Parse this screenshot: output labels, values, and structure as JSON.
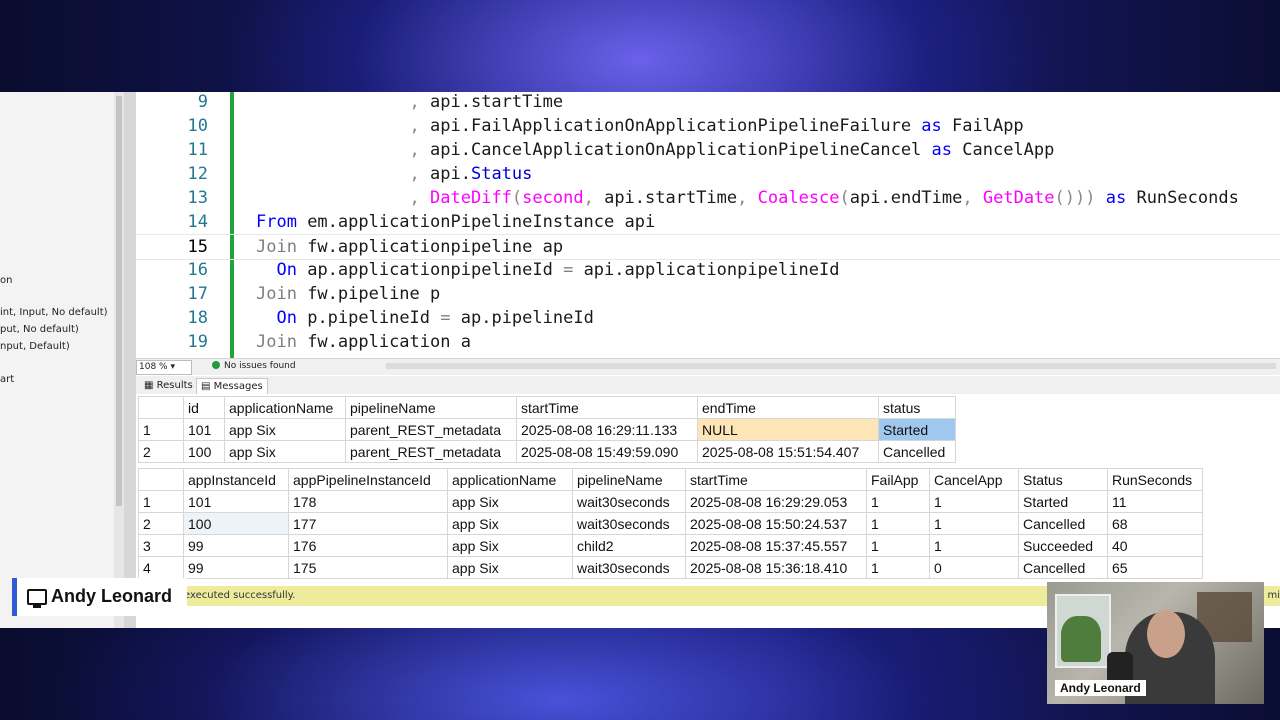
{
  "left_pane": {
    "fragments": [
      "on",
      "int, Input, No default)",
      "put, No default)",
      "nput, Default)",
      "art"
    ]
  },
  "editor": {
    "lines": [
      {
        "num": "9",
        "html": "               <span class=\"pu\">,</span> api.startTime"
      },
      {
        "num": "10",
        "html": "               <span class=\"pu\">,</span> api.FailApplicationOnApplicationPipelineFailure <span class=\"kw\">as</span> FailApp"
      },
      {
        "num": "11",
        "html": "               <span class=\"pu\">,</span> api.CancelApplicationOnApplicationPipelineCancel <span class=\"kw\">as</span> CancelApp"
      },
      {
        "num": "12",
        "html": "               <span class=\"pu\">,</span> api.<span class=\"sys\">Status</span>"
      },
      {
        "num": "13",
        "html": "               <span class=\"pu\">,</span> <span class=\"fn\">DateDiff</span><span class=\"pu\">(</span><span class=\"fn\">second</span><span class=\"pu\">,</span> api.startTime<span class=\"pu\">,</span> <span class=\"fn\">Coalesce</span><span class=\"pu\">(</span>api.endTime<span class=\"pu\">,</span> <span class=\"fn\">GetDate</span><span class=\"pu\">()))</span> <span class=\"kw\">as</span> RunSeconds"
      },
      {
        "num": "14",
        "html": "<span class=\"kw\">From</span> em.applicationPipelineInstance api"
      },
      {
        "num": "15",
        "html": "<span class=\"gr\">Join</span> fw.applicationpipeline ap"
      },
      {
        "num": "16",
        "html": "  <span class=\"kw\">On</span> ap.applicationpipelineId <span class=\"gr\">=</span> api.applicationpipelineId"
      },
      {
        "num": "17",
        "html": "<span class=\"gr\">Join</span> fw.pipeline p"
      },
      {
        "num": "18",
        "html": "  <span class=\"kw\">On</span> p.pipelineId <span class=\"gr\">=</span> ap.pipelineId"
      },
      {
        "num": "19",
        "html": "<span class=\"gr\">Join</span> fw.application a"
      }
    ],
    "current_line": "15"
  },
  "status_strip": {
    "zoom": "108 %",
    "issues": "No issues found"
  },
  "tabs": {
    "results": "Results",
    "messages": "Messages"
  },
  "grid1": {
    "columns": [
      "",
      "id",
      "applicationName",
      "pipelineName",
      "startTime",
      "endTime",
      "status"
    ],
    "rows": [
      [
        "1",
        "101",
        "app Six",
        "parent_REST_metadata",
        "2025-08-08 16:29:11.133",
        "NULL",
        "Started"
      ],
      [
        "2",
        "100",
        "app Six",
        "parent_REST_metadata",
        "2025-08-08 15:49:59.090",
        "2025-08-08 15:51:54.407",
        "Cancelled"
      ]
    ]
  },
  "grid2": {
    "columns": [
      "",
      "appInstanceId",
      "appPipelineInstanceId",
      "applicationName",
      "pipelineName",
      "startTime",
      "FailApp",
      "CancelApp",
      "Status",
      "RunSeconds"
    ],
    "rows": [
      [
        "1",
        "101",
        "178",
        "app Six",
        "wait30seconds",
        "2025-08-08 16:29:29.053",
        "1",
        "1",
        "Started",
        "11"
      ],
      [
        "2",
        "100",
        "177",
        "app Six",
        "wait30seconds",
        "2025-08-08 15:50:24.537",
        "1",
        "1",
        "Cancelled",
        "68"
      ],
      [
        "3",
        "99",
        "176",
        "app Six",
        "child2",
        "2025-08-08 15:37:45.557",
        "1",
        "1",
        "Succeeded",
        "40"
      ],
      [
        "4",
        "99",
        "175",
        "app Six",
        "wait30seconds",
        "2025-08-08 15:36:18.410",
        "1",
        "0",
        "Cancelled",
        "65"
      ]
    ]
  },
  "query_status": {
    "message": "executed successfully.",
    "right_fragment": "mi"
  },
  "presenter": {
    "name": "Andy Leonard",
    "webcam_label": "Andy Leonard"
  }
}
